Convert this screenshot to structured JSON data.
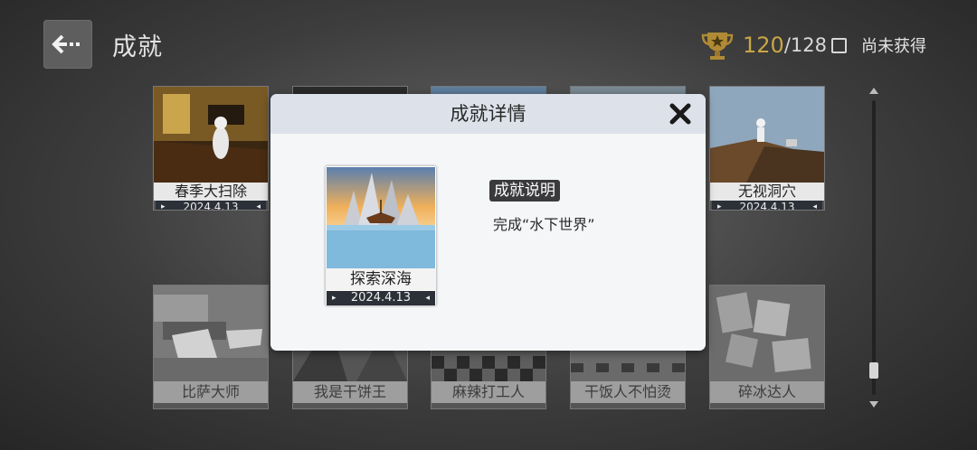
{
  "header": {
    "title": "成就",
    "count_unlocked": "120",
    "count_total": "/128",
    "not_obtained_label": "尚未获得"
  },
  "grid": {
    "top_row": [
      {
        "name": "春季大扫除",
        "date": "2024.4.13"
      },
      {
        "name": "",
        "date": ""
      },
      {
        "name": "",
        "date": ""
      },
      {
        "name": "",
        "date": ""
      },
      {
        "name": "无视洞穴",
        "date": "2024.4.13"
      }
    ],
    "bottom_row": [
      {
        "name": "比萨大师"
      },
      {
        "name": "我是干饼王"
      },
      {
        "name": "麻辣打工人"
      },
      {
        "name": "干饭人不怕烫"
      },
      {
        "name": "碎冰达人"
      }
    ]
  },
  "modal": {
    "title": "成就详情",
    "achievement_name": "探索深海",
    "achievement_date": "2024.4.13",
    "desc_title": "成就说明",
    "desc_text": "完成“水下世界”"
  },
  "scroll": {
    "position": 0.94
  },
  "colors": {
    "count_gold": "#c9a645",
    "date_bar": "#2c3038",
    "modal_header": "#dde2ea"
  }
}
